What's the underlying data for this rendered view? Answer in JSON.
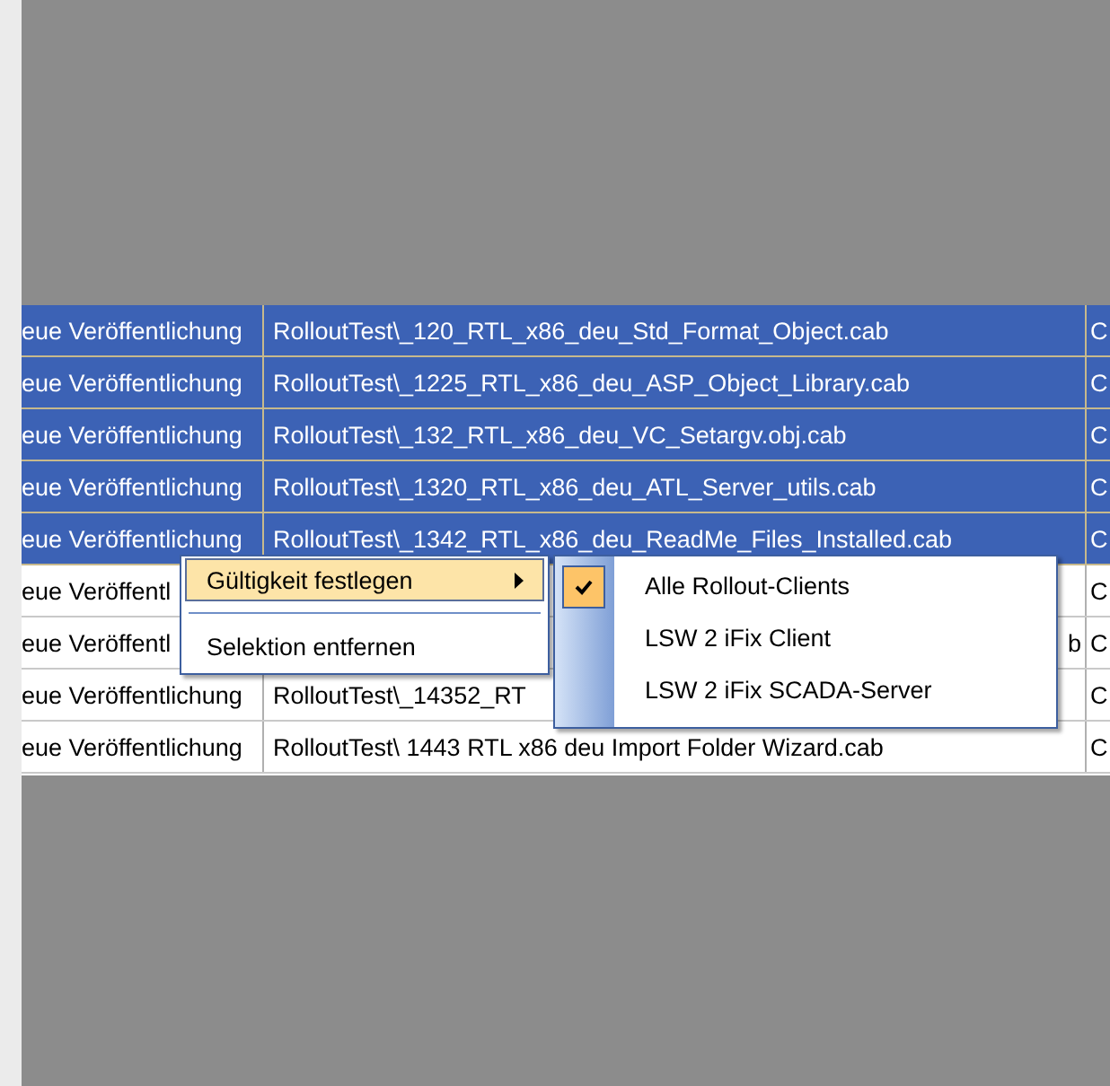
{
  "table": {
    "rows": [
      {
        "selected": true,
        "cells": [
          "eue Veröffentlichung",
          "RolloutTest\\_120_RTL_x86_deu_Std_Format_Object.cab",
          "C"
        ]
      },
      {
        "selected": true,
        "cells": [
          "eue Veröffentlichung",
          "RolloutTest\\_1225_RTL_x86_deu_ASP_Object_Library.cab",
          "C"
        ]
      },
      {
        "selected": true,
        "cells": [
          "eue Veröffentlichung",
          "RolloutTest\\_132_RTL_x86_deu_VC_Setargv.obj.cab",
          "C"
        ]
      },
      {
        "selected": true,
        "cells": [
          "eue Veröffentlichung",
          "RolloutTest\\_1320_RTL_x86_deu_ATL_Server_utils.cab",
          "C"
        ]
      },
      {
        "selected": true,
        "cells": [
          "eue Veröffentlichung",
          "RolloutTest\\_1342_RTL_x86_deu_ReadMe_Files_Installed.cab",
          "C"
        ]
      },
      {
        "selected": false,
        "cells": [
          "eue Veröffentl",
          "",
          "C"
        ]
      },
      {
        "selected": false,
        "cells": [
          "eue Veröffentl",
          "b",
          "C"
        ]
      },
      {
        "selected": false,
        "cells": [
          "eue Veröffentlichung",
          "RolloutTest\\_14352_RT",
          "C"
        ]
      },
      {
        "selected": false,
        "cells": [
          "eue Veröffentlichung",
          "RolloutTest\\ 1443 RTL x86 deu Import Folder Wizard.cab",
          "C"
        ]
      }
    ]
  },
  "context_menu": {
    "items": [
      {
        "kind": "item",
        "label": "Gültigkeit festlegen",
        "selected": true,
        "has_submenu": true
      },
      {
        "kind": "separator"
      },
      {
        "kind": "item",
        "label": "Selektion entfernen",
        "selected": false,
        "has_submenu": false
      }
    ]
  },
  "submenu": {
    "items": [
      {
        "label": "Alle Rollout-Clients",
        "checked": true
      },
      {
        "label": "LSW 2 iFix Client",
        "checked": false
      },
      {
        "label": "LSW 2 iFix SCADA-Server",
        "checked": false
      }
    ]
  }
}
